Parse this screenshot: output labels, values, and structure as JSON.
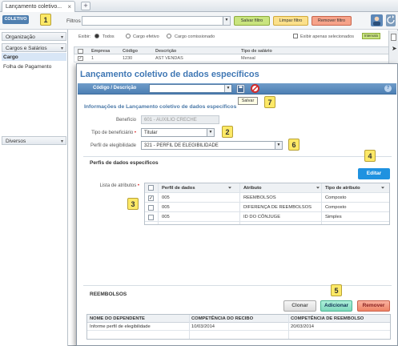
{
  "tab": {
    "title": "Lançamento coletivo...",
    "close": "×",
    "add": "+"
  },
  "toolbar": {
    "coletivo": "COLETIVO",
    "filtros_label": "Filtros",
    "save_filter": "Salvar filtro",
    "clear_filter": "Limpar filtro",
    "remove_filter": "Remover filtro"
  },
  "sidebar": {
    "org": "Organização",
    "cargos": "Cargos e Salários",
    "items": [
      "Cargo",
      "Folha de Pagamento"
    ],
    "diversos": "Diversos"
  },
  "backfilter": {
    "exibir": "Exibir:",
    "todos": "Todos",
    "efetivo": "Cargo efetivo",
    "comissionado": "Cargo comissionado",
    "somente": "Exibir apenas selecionados",
    "interval": "Intervalo"
  },
  "backgrid": {
    "headers": [
      "Empresa",
      "Código",
      "Descrição",
      "Tipo de salário"
    ],
    "row": [
      "1",
      "1230",
      "AST VENDAS",
      "Mensal"
    ]
  },
  "modal": {
    "title": "Lançamento coletivo de dados específicos",
    "codigo_label": "Código / Descrição",
    "save_tooltip": "Salvar",
    "help": "?",
    "section1": "Informações de Lançamento coletivo de dados específicos",
    "beneficio_label": "Benefício",
    "beneficio_value": "601 - AUXILIO CRECHE",
    "tipo_label": "Tipo de beneficiário",
    "tipo_value": "Titular",
    "perfil_label": "Perfil de elegibilidade",
    "perfil_value": "321 - PERFIL DE ELEGIBILIDADE",
    "section2": "Perfis de dados específicos",
    "editar": "Editar",
    "lista_label": "Lista de atributos",
    "attr_headers": [
      "Perfil de dados",
      "Atributo",
      "Tipo de atributo"
    ],
    "attr_rows": [
      {
        "checked": "✓",
        "perfil": "005",
        "atributo": "REEMBOLSOS",
        "tipo": "Composto"
      },
      {
        "checked": "",
        "perfil": "005",
        "atributo": "DIFERENÇA DE REEMBOLSOS",
        "tipo": "Composto"
      },
      {
        "checked": "",
        "perfil": "005",
        "atributo": "ID DO CÔNJUGE",
        "tipo": "Simples"
      }
    ],
    "reembolsos_title": "REEMBOLSOS",
    "clonar": "Clonar",
    "adicionar": "Adicionar",
    "remover": "Remover",
    "bottom_headers": [
      "NOME DO DEPENDENTE",
      "COMPETÊNCIA DO RECIBO",
      "COMPETÊNCIA DE REEMBOLSO"
    ],
    "bottom_row": [
      "Informe perfil de elegibilidade",
      "10/03/2014",
      "20/03/2014"
    ]
  },
  "callouts": [
    "1",
    "2",
    "3",
    "4",
    "5",
    "6",
    "7"
  ]
}
